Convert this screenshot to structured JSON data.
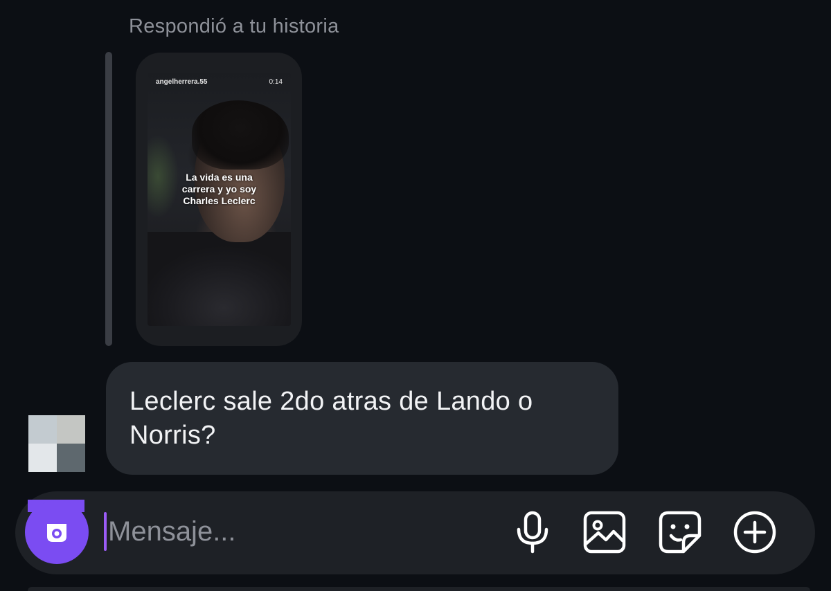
{
  "thread": {
    "reply_context": "Respondió a tu historia",
    "story": {
      "username": "angelherrera.55",
      "timestamp": "0:14",
      "caption": "La vida es una\ncarrera y yo soy\nCharles Leclerc"
    },
    "message": {
      "text": "Leclerc sale 2do atras de Lando o Norris?"
    }
  },
  "composer": {
    "placeholder": "Mensaje...",
    "value": "",
    "icons": [
      "camera-icon",
      "microphone-icon",
      "gallery-icon",
      "sticker-icon",
      "add-icon"
    ]
  },
  "colors": {
    "background": "#0c0f14",
    "bubble": "#262a30",
    "composer": "#1e2126",
    "accent": "#7b4cf2",
    "cursor": "#9b5cf6",
    "muted_text": "#8e9199"
  }
}
